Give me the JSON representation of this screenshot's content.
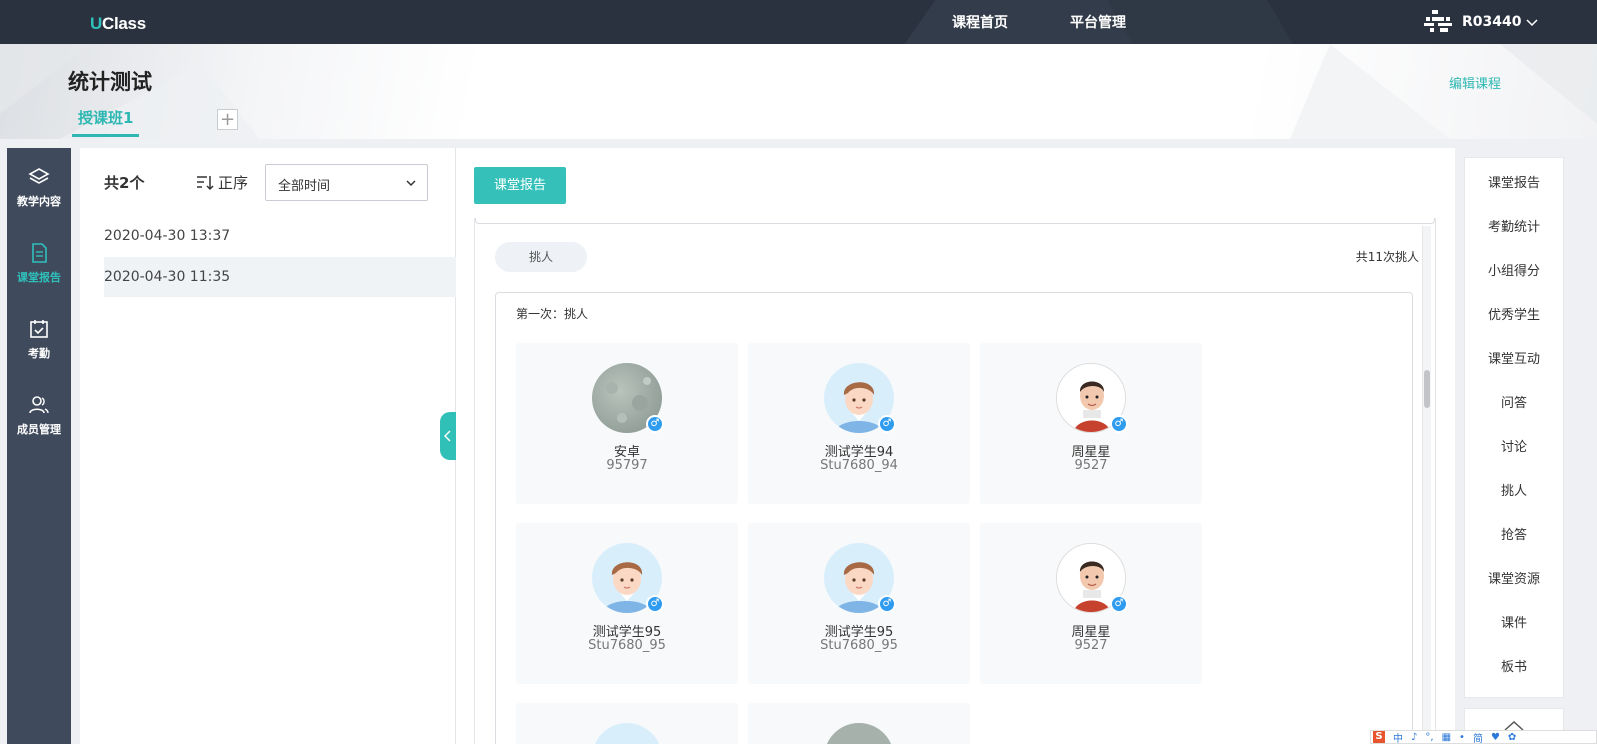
{
  "header": {
    "logo_u": "U",
    "logo_rest": "Class",
    "nav": [
      "课程首页",
      "平台管理"
    ],
    "user": "R03440"
  },
  "course": {
    "title": "统计测试",
    "edit_label": "编辑课程",
    "tab": "授课班1",
    "add_tab": "+"
  },
  "left_nav": [
    {
      "label": "教学内容",
      "icon": "layers-icon"
    },
    {
      "label": "课堂报告",
      "icon": "document-icon"
    },
    {
      "label": "考勤",
      "icon": "calendar-check-icon"
    },
    {
      "label": "成员管理",
      "icon": "users-icon"
    }
  ],
  "records": {
    "count_prefix": "共",
    "count": "2",
    "count_suffix": "个",
    "sort_label": "正序",
    "time_filter": "全部时间",
    "items": [
      "2020-04-30 13:37",
      "2020-04-30 11:35"
    ]
  },
  "main": {
    "report_button": "课堂报告",
    "section_pill": "挑人",
    "total_picks": "共11次挑人",
    "pick_title": "第一次：挑人",
    "gender_symbol": "♂",
    "students": [
      {
        "name": "安卓",
        "id": "95797",
        "avatar": "texture"
      },
      {
        "name": "测试学生94",
        "id": "Stu7680_94",
        "avatar": "cartoon"
      },
      {
        "name": "周星星",
        "id": "9527",
        "avatar": "photo"
      },
      {
        "name": "测试学生95",
        "id": "Stu7680_95",
        "avatar": "cartoon"
      },
      {
        "name": "测试学生95",
        "id": "Stu7680_95",
        "avatar": "cartoon"
      },
      {
        "name": "周星星",
        "id": "9527",
        "avatar": "photo"
      }
    ]
  },
  "right_nav": [
    "课堂报告",
    "考勤统计",
    "小组得分",
    "优秀学生",
    "课堂互动",
    "问答",
    "讨论",
    "挑人",
    "抢答",
    "课堂资源",
    "课件",
    "板书"
  ],
  "ime": [
    "S",
    "中",
    "♪",
    "°,",
    "▦",
    "•",
    "简",
    "♥",
    "✿"
  ],
  "colors": {
    "accent": "#2fc0bc",
    "topbar": "#2a323f",
    "sidebar": "#3f4a5c",
    "badge": "#2f9cf0"
  }
}
